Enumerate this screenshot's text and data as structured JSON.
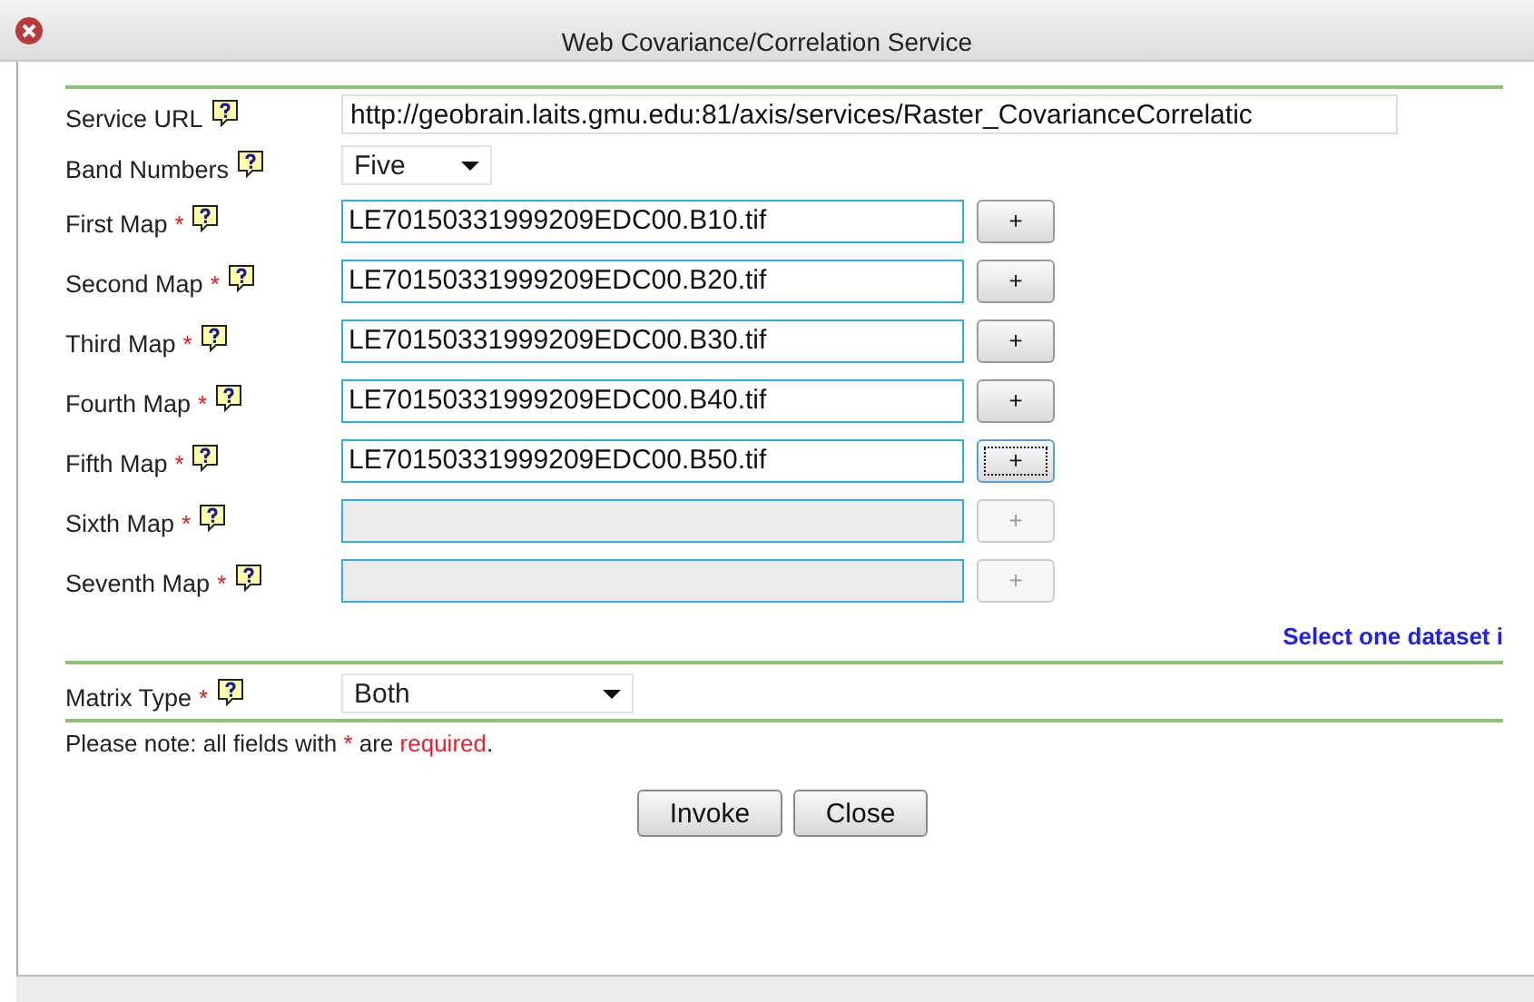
{
  "window": {
    "title": "Web Covariance/Correlation Service"
  },
  "service_url": {
    "label": "Service URL",
    "value": "http://geobrain.laits.gmu.edu:81/axis/services/Raster_CovarianceCorrelatic"
  },
  "band_numbers": {
    "label": "Band Numbers",
    "value": "Five"
  },
  "maps": [
    {
      "label": "First Map",
      "mark": "*",
      "value": "LE70150331999209EDC00.B10.tif",
      "button": "+",
      "disabled": false,
      "focused": false
    },
    {
      "label": "Second Map",
      "mark": "*",
      "value": "LE70150331999209EDC00.B20.tif",
      "button": "+",
      "disabled": false,
      "focused": false
    },
    {
      "label": "Third Map",
      "mark": "*",
      "value": "LE70150331999209EDC00.B30.tif",
      "button": "+",
      "disabled": false,
      "focused": false
    },
    {
      "label": "Fourth Map",
      "mark": "*",
      "value": "LE70150331999209EDC00.B40.tif",
      "button": "+",
      "disabled": false,
      "focused": false
    },
    {
      "label": "Fifth Map",
      "mark": "*",
      "value": "LE70150331999209EDC00.B50.tif",
      "button": "+",
      "disabled": false,
      "focused": true
    },
    {
      "label": "Sixth Map",
      "mark": "*",
      "button": "+",
      "disabled": true,
      "focused": false
    },
    {
      "label": "Seventh Map",
      "mark": "*",
      "button": "+",
      "disabled": true,
      "focused": false
    }
  ],
  "hint": "Select one dataset i",
  "matrix_type": {
    "label": "Matrix Type",
    "mark": "*",
    "value": "Both"
  },
  "note": [
    {
      "text": "Please note: all fields with ",
      "kind": "plain"
    },
    {
      "text": "*",
      "kind": "red"
    },
    {
      "text": " are ",
      "kind": "plain"
    },
    {
      "text": "required",
      "kind": "red"
    },
    {
      "text": ".",
      "kind": "plain"
    }
  ],
  "buttons": [
    "Invoke",
    "Close"
  ]
}
